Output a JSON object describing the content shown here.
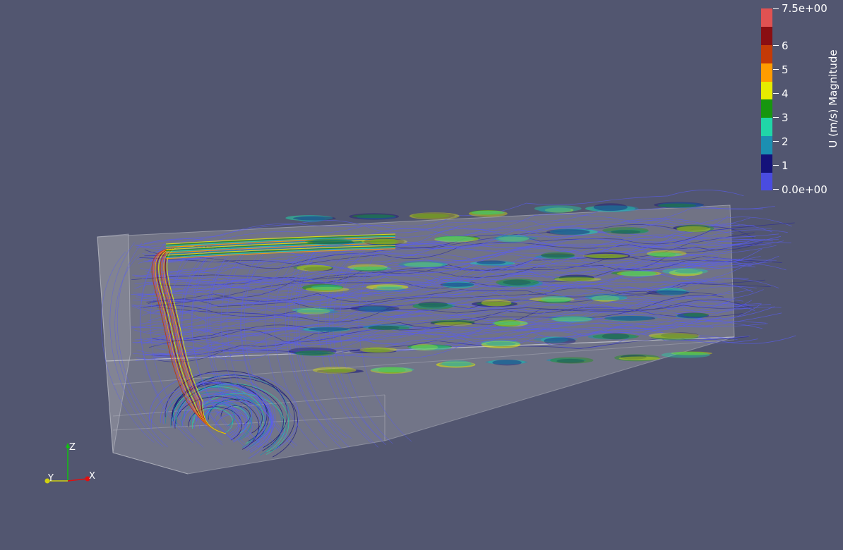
{
  "viewer": {
    "background_color": "#525670",
    "geometry_color": "#9a9ca6"
  },
  "colorbar": {
    "title": "U (m/s) Magnitude",
    "range_min": 0.0,
    "range_max": 7.5,
    "labels": {
      "max": "7.5e+00",
      "l6": "6",
      "l5": "5",
      "l4": "4",
      "l3": "3",
      "l2": "2",
      "l1": "1",
      "min": "0.0e+00"
    },
    "colors": [
      "#4a4ce0",
      "#14127a",
      "#1b8fb2",
      "#20d6a8",
      "#17960f",
      "#e6ec00",
      "#ff9c00",
      "#c43a06",
      "#8a0e12",
      "#e05252"
    ]
  },
  "axes": {
    "x_label": "X",
    "y_label": "Y",
    "z_label": "Z",
    "x_color": "#e01010",
    "y_color": "#d0d010",
    "z_color": "#10c010"
  }
}
